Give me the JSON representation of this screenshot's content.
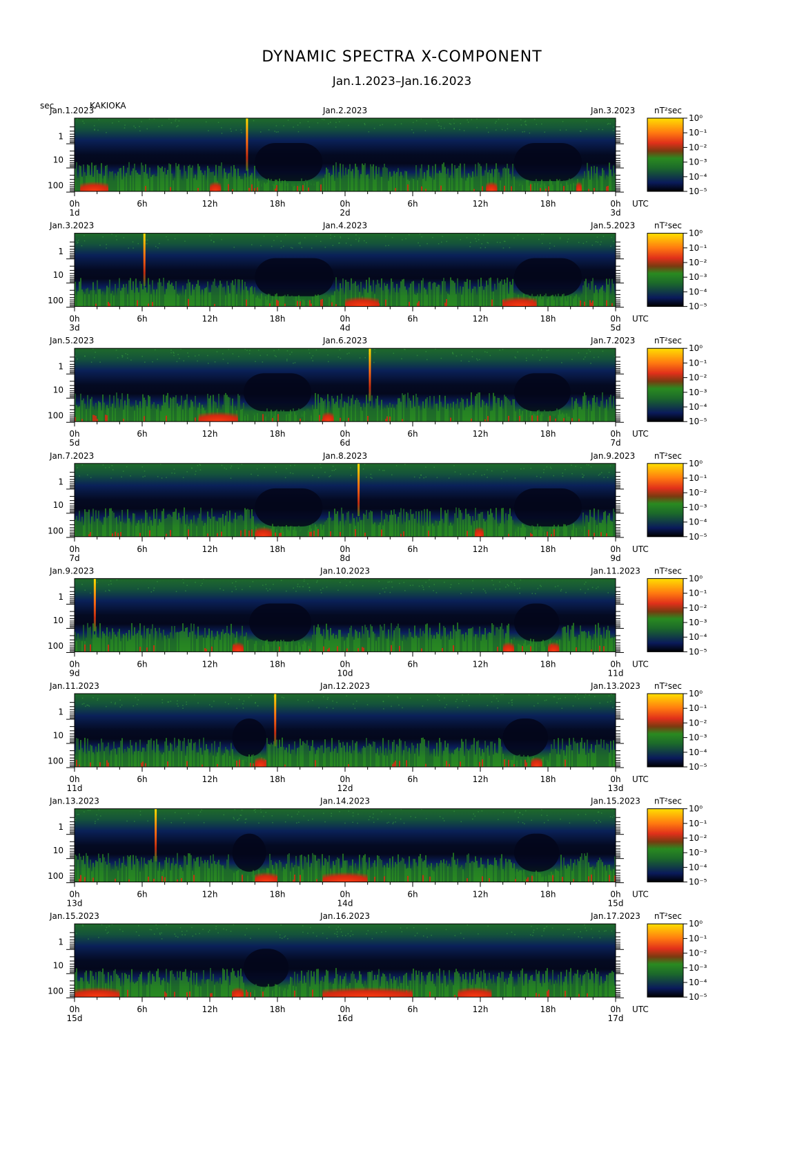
{
  "title": "DYNAMIC SPECTRA X-COMPONENT",
  "subtitle": "Jan.1.2023–Jan.16.2023",
  "unit_label": "sec",
  "station": "KAKIOKA",
  "hour_ticks": [
    "0h",
    "6h",
    "12h",
    "18h",
    "0h",
    "6h",
    "12h",
    "18h",
    "0h"
  ],
  "utc_label": "UTC",
  "colorbar_unit": "nT²sec",
  "colors": {
    "low": "#000000",
    "mid1": "#0a1f5c",
    "mid2": "#1c7a2a",
    "high1": "#e0301a",
    "high2": "#ffe000"
  },
  "chart_data": {
    "type": "heatmap",
    "y_axis": {
      "label": "sec",
      "scale": "log",
      "ticks": [
        "1",
        "10",
        "100"
      ]
    },
    "x_axis": {
      "label": "UTC",
      "ticks": [
        "0h",
        "6h",
        "12h",
        "18h",
        "0h",
        "6h",
        "12h",
        "18h",
        "0h"
      ]
    },
    "colorbar": {
      "unit": "nT²sec",
      "scale": "log",
      "ticks": [
        "10⁰",
        "10⁻¹",
        "10⁻²",
        "10⁻³",
        "10⁻⁴",
        "10⁻⁵"
      ]
    },
    "panels": [
      {
        "date_left": "Jan.1.2023",
        "date_mid": "Jan.2.2023",
        "date_right": "Jan.3.2023",
        "day_left": "1d",
        "day_mid": "2d",
        "day_right": "3d",
        "spikes": [
          15.3
        ],
        "quiet": [
          [
            16,
            22
          ],
          [
            39,
            45
          ]
        ],
        "hot": [
          [
            0.5,
            3
          ],
          [
            12,
            13
          ],
          [
            36.5,
            37.5
          ],
          [
            44.5,
            45
          ]
        ]
      },
      {
        "date_left": "Jan.3.2023",
        "date_mid": "Jan.4.2023",
        "date_right": "Jan.5.2023",
        "day_left": "3d",
        "day_mid": "4d",
        "day_right": "5d",
        "spikes": [
          6.2
        ],
        "quiet": [
          [
            16,
            23
          ],
          [
            39,
            45
          ]
        ],
        "hot": [
          [
            24,
            27
          ],
          [
            38,
            41
          ]
        ]
      },
      {
        "date_left": "Jan.5.2023",
        "date_mid": "Jan.6.2023",
        "date_right": "Jan.7.2023",
        "day_left": "5d",
        "day_mid": "6d",
        "day_right": "7d",
        "spikes": [
          26.2
        ],
        "quiet": [
          [
            15,
            21
          ],
          [
            39,
            44
          ]
        ],
        "hot": [
          [
            11,
            14.5
          ],
          [
            22,
            23
          ]
        ]
      },
      {
        "date_left": "Jan.7.2023",
        "date_mid": "Jan.8.2023",
        "date_right": "Jan.9.2023",
        "day_left": "7d",
        "day_mid": "8d",
        "day_right": "9d",
        "spikes": [
          25.2
        ],
        "quiet": [
          [
            16,
            22
          ],
          [
            39,
            45
          ]
        ],
        "hot": [
          [
            16,
            17.5
          ],
          [
            35.5,
            36.3
          ]
        ]
      },
      {
        "date_left": "Jan.9.2023",
        "date_mid": "Jan.10.2023",
        "date_right": "Jan.11.2023",
        "day_left": "9d",
        "day_mid": "10d",
        "day_right": "11d",
        "spikes": [
          1.8
        ],
        "quiet": [
          [
            15.5,
            21
          ],
          [
            39,
            43
          ]
        ],
        "hot": [
          [
            14,
            15
          ],
          [
            38,
            39
          ],
          [
            42,
            43
          ]
        ]
      },
      {
        "date_left": "Jan.11.2023",
        "date_mid": "Jan.12.2023",
        "date_right": "Jan.13.2023",
        "day_left": "11d",
        "day_mid": "12d",
        "day_right": "13d",
        "spikes": [
          17.8
        ],
        "quiet": [
          [
            14,
            17
          ],
          [
            38,
            42
          ]
        ],
        "hot": [
          [
            16,
            17
          ],
          [
            40.5,
            41.5
          ]
        ]
      },
      {
        "date_left": "Jan.13.2023",
        "date_mid": "Jan.14.2023",
        "date_right": "Jan.15.2023",
        "day_left": "13d",
        "day_mid": "14d",
        "day_right": "15d",
        "spikes": [
          7.2
        ],
        "quiet": [
          [
            14,
            17
          ],
          [
            39,
            43
          ]
        ],
        "hot": [
          [
            16,
            18
          ],
          [
            22,
            26
          ]
        ]
      },
      {
        "date_left": "Jan.15.2023",
        "date_mid": "Jan.16.2023",
        "date_right": "Jan.17.2023",
        "day_left": "15d",
        "day_mid": "16d",
        "day_right": "17d",
        "spikes": [],
        "quiet": [
          [
            15,
            19
          ]
        ],
        "hot": [
          [
            0,
            4
          ],
          [
            14,
            15
          ],
          [
            22,
            30
          ],
          [
            34,
            37
          ]
        ]
      }
    ]
  }
}
